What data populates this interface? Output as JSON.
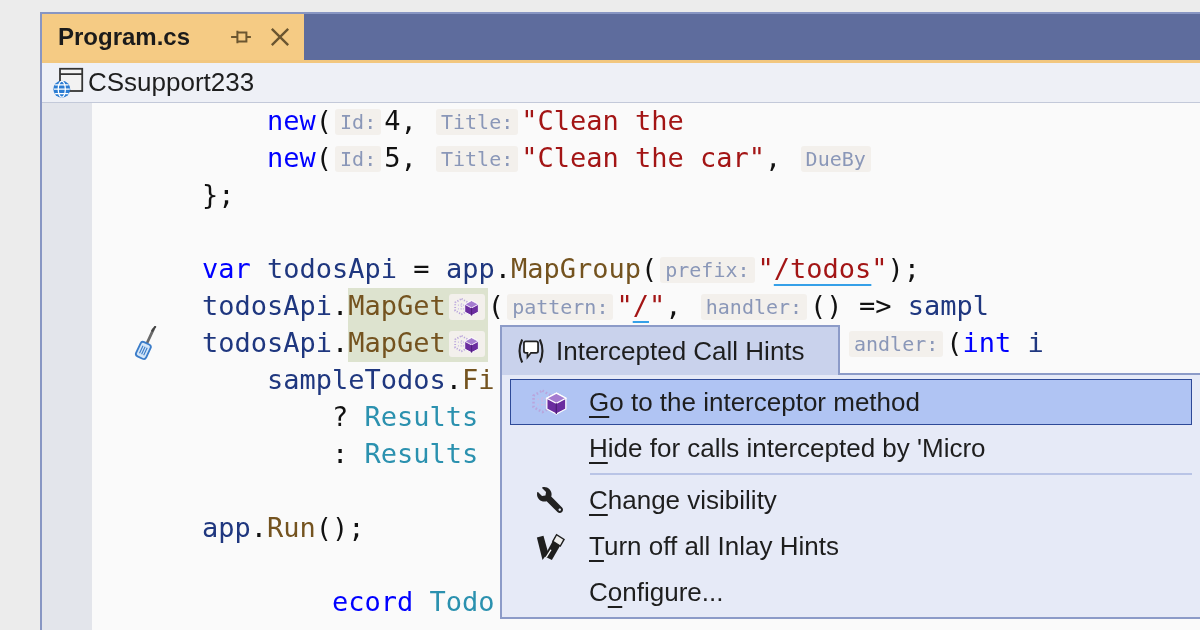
{
  "tabs": [
    {
      "label": "Program.cs",
      "selected": true
    }
  ],
  "navigation_bar": {
    "project": "CSsupport233"
  },
  "editor": {
    "lines": [
      {
        "quick_actions": false,
        "tokens": [
          {
            "kind": "keyword",
            "text": "    new"
          },
          {
            "kind": "punct",
            "text": "("
          },
          {
            "kind": "hint",
            "text": "Id:"
          },
          {
            "kind": "punct",
            "text": "4, "
          },
          {
            "kind": "hint",
            "text": "Title:"
          },
          {
            "kind": "string",
            "text": "\"Clean the"
          }
        ]
      },
      {
        "quick_actions": false,
        "tokens": [
          {
            "kind": "keyword",
            "text": "    new"
          },
          {
            "kind": "punct",
            "text": "("
          },
          {
            "kind": "hint",
            "text": "Id:"
          },
          {
            "kind": "punct",
            "text": "5, "
          },
          {
            "kind": "hint",
            "text": "Title:"
          },
          {
            "kind": "string",
            "text": "\"Clean the car\""
          },
          {
            "kind": "punct",
            "text": ", "
          },
          {
            "kind": "hint",
            "text": "DueBy"
          }
        ]
      },
      {
        "quick_actions": false,
        "tokens": [
          {
            "kind": "punct",
            "text": "};"
          }
        ]
      },
      {
        "quick_actions": false
      },
      {
        "quick_actions": false,
        "tokens": [
          {
            "kind": "keyword",
            "text": "var"
          },
          {
            "kind": "identifier",
            "text": " todosApi"
          },
          {
            "kind": "punct",
            "text": " = "
          },
          {
            "kind": "identifier",
            "text": "app"
          },
          {
            "kind": "punct",
            "text": "."
          },
          {
            "kind": "method",
            "text": "MapGroup"
          },
          {
            "kind": "punct",
            "text": "("
          },
          {
            "kind": "hint",
            "text": "prefix:"
          },
          {
            "kind": "string",
            "text": "\""
          },
          {
            "kind": "string",
            "text": "/todos",
            "underlined": true
          },
          {
            "kind": "string",
            "text": "\""
          },
          {
            "kind": "punct",
            "text": ");"
          }
        ]
      },
      {
        "quick_actions": false,
        "tokens": [
          {
            "kind": "identifier",
            "text": "todosApi"
          },
          {
            "kind": "punct",
            "text": "."
          },
          {
            "kind": "method",
            "text": "MapGet",
            "highlighted": true,
            "intercepted": true
          },
          {
            "kind": "punct",
            "text": "("
          },
          {
            "kind": "hint",
            "text": "pattern:"
          },
          {
            "kind": "string",
            "text": "\""
          },
          {
            "kind": "string",
            "text": "/",
            "underlined": true
          },
          {
            "kind": "string",
            "text": "\""
          },
          {
            "kind": "punct",
            "text": ", "
          },
          {
            "kind": "hint",
            "text": "handler:"
          },
          {
            "kind": "punct",
            "text": "() => "
          },
          {
            "kind": "identifier",
            "text": "sampl"
          }
        ]
      },
      {
        "quick_actions": true,
        "tokens": [
          {
            "kind": "identifier",
            "text": "todosApi"
          },
          {
            "kind": "punct",
            "text": "."
          },
          {
            "kind": "method",
            "text": "MapGet",
            "highlighted": true,
            "intercepted": true
          }
        ],
        "right_tokens": [
          {
            "kind": "hint",
            "text": "andler:"
          },
          {
            "kind": "punct",
            "text": "("
          },
          {
            "kind": "keyword",
            "text": "int"
          },
          {
            "kind": "identifier",
            "text": " i"
          }
        ]
      },
      {
        "quick_actions": false,
        "tokens": [
          {
            "kind": "identifier",
            "text": "    sampleTodos"
          },
          {
            "kind": "punct",
            "text": "."
          },
          {
            "kind": "method",
            "text": "Fi"
          }
        ]
      },
      {
        "quick_actions": false,
        "tokens": [
          {
            "kind": "punct",
            "text": "        ? "
          },
          {
            "kind": "type",
            "text": "Results"
          }
        ]
      },
      {
        "quick_actions": false,
        "tokens": [
          {
            "kind": "punct",
            "text": "        : "
          },
          {
            "kind": "type",
            "text": "Results"
          }
        ]
      },
      {
        "quick_actions": false
      },
      {
        "quick_actions": false,
        "tokens": [
          {
            "kind": "identifier",
            "text": "app"
          },
          {
            "kind": "punct",
            "text": "."
          },
          {
            "kind": "method",
            "text": "Run"
          },
          {
            "kind": "punct",
            "text": "();"
          }
        ]
      },
      {
        "quick_actions": false
      },
      {
        "quick_actions": false,
        "tokens": [
          {
            "kind": "keyword",
            "text": "        ecord"
          },
          {
            "kind": "type",
            "text": " Todo"
          }
        ]
      }
    ]
  },
  "context_menu": {
    "header": "Intercepted Call Hints",
    "items": [
      {
        "kind": "command",
        "selected": true,
        "label": [
          {
            "text": "G",
            "access_key": true
          },
          {
            "text": "o to the interceptor method",
            "access_key": false
          }
        ]
      },
      {
        "kind": "command",
        "selected": false,
        "label": [
          {
            "text": "H",
            "access_key": true
          },
          {
            "text": "ide for calls intercepted by 'Micro",
            "access_key": false
          }
        ]
      },
      {
        "kind": "separator"
      },
      {
        "kind": "command",
        "selected": false,
        "label": [
          {
            "text": "C",
            "access_key": true
          },
          {
            "text": "hange visibility",
            "access_key": false
          }
        ]
      },
      {
        "kind": "command",
        "selected": false,
        "label": [
          {
            "text": "T",
            "access_key": true
          },
          {
            "text": "urn off all Inlay Hints",
            "access_key": false
          }
        ]
      },
      {
        "kind": "command",
        "selected": false,
        "label": [
          {
            "text": "C",
            "access_key": false
          },
          {
            "text": "o",
            "access_key": true
          },
          {
            "text": "nfigure...",
            "access_key": false
          }
        ]
      }
    ]
  }
}
